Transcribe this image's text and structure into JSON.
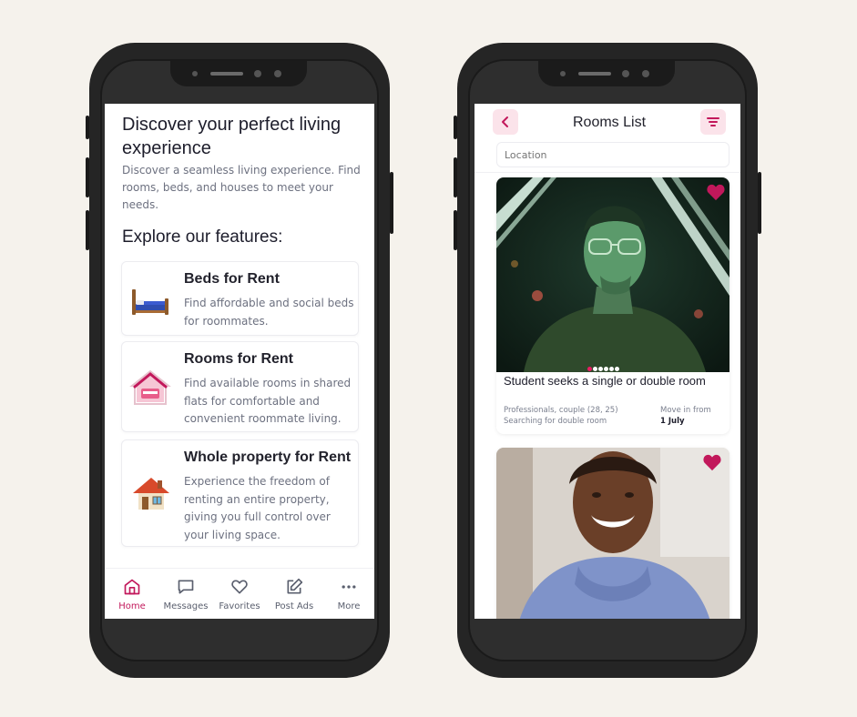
{
  "left_phone": {
    "heading": "Discover your perfect living experience",
    "description": "Discover a seamless living experience. Find rooms, beds, and houses to meet your needs.",
    "explore_title": "Explore our features:",
    "features": [
      {
        "title": "Beds for Rent",
        "desc": "Find affordable and social beds for roommates.",
        "icon": "bed-icon"
      },
      {
        "title": "Rooms for Rent",
        "desc": "Find available rooms in shared flats for comfortable and convenient roommate living.",
        "icon": "room-house-icon"
      },
      {
        "title": "Whole property for Rent",
        "desc": "Experience the freedom of renting an entire property, giving you full control over your living space.",
        "icon": "house-icon"
      }
    ],
    "tabs": [
      {
        "label": "Home",
        "icon": "home-icon",
        "active": true
      },
      {
        "label": "Messages",
        "icon": "chat-icon"
      },
      {
        "label": "Favorites",
        "icon": "heart-icon"
      },
      {
        "label": "Post Ads",
        "icon": "edit-icon"
      },
      {
        "label": "More",
        "icon": "more-icon"
      }
    ]
  },
  "right_phone": {
    "title": "Rooms List",
    "search": {
      "placeholder": "Location",
      "value": ""
    },
    "listings": [
      {
        "title": "Student seeks a single or double room",
        "info_line1": "Professionals, couple (28, 25)",
        "info_line2": "Searching for double room",
        "move_in_label": "Move in from",
        "move_in_date": "1 July",
        "favorited": true
      },
      {
        "favorited": true
      }
    ]
  },
  "colors": {
    "accent": "#c2185b",
    "accent_soft": "#fbe3ea",
    "background": "#f5f2ec"
  }
}
